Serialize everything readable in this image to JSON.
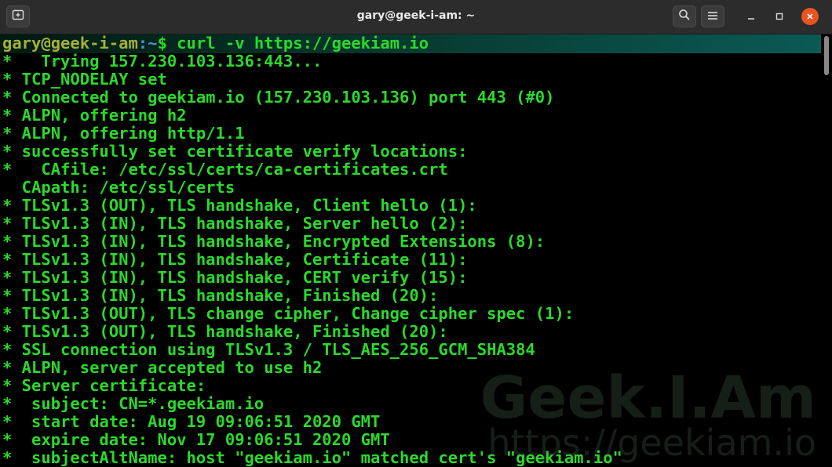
{
  "window": {
    "title": "gary@geek-i-am: ~",
    "new_tab_icon": "new-tab-icon",
    "search_icon": "search-icon",
    "menu_icon": "hamburger-menu-icon",
    "close_color": "#e95420"
  },
  "prompt": {
    "user_host": "gary@geek-i-am",
    "path": ":~",
    "symbol": "$ ",
    "command": "curl -v https://geekiam.io"
  },
  "output_lines": [
    "*   Trying 157.230.103.136:443...",
    "* TCP_NODELAY set",
    "* Connected to geekiam.io (157.230.103.136) port 443 (#0)",
    "* ALPN, offering h2",
    "* ALPN, offering http/1.1",
    "* successfully set certificate verify locations:",
    "*   CAfile: /etc/ssl/certs/ca-certificates.crt",
    "  CApath: /etc/ssl/certs",
    "* TLSv1.3 (OUT), TLS handshake, Client hello (1):",
    "* TLSv1.3 (IN), TLS handshake, Server hello (2):",
    "* TLSv1.3 (IN), TLS handshake, Encrypted Extensions (8):",
    "* TLSv1.3 (IN), TLS handshake, Certificate (11):",
    "* TLSv1.3 (IN), TLS handshake, CERT verify (15):",
    "* TLSv1.3 (IN), TLS handshake, Finished (20):",
    "* TLSv1.3 (OUT), TLS change cipher, Change cipher spec (1):",
    "* TLSv1.3 (OUT), TLS handshake, Finished (20):",
    "* SSL connection using TLSv1.3 / TLS_AES_256_GCM_SHA384",
    "* ALPN, server accepted to use h2",
    "* Server certificate:",
    "*  subject: CN=*.geekiam.io",
    "*  start date: Aug 19 09:06:51 2020 GMT",
    "*  expire date: Nov 17 09:06:51 2020 GMT",
    "*  subjectAltName: host \"geekiam.io\" matched cert's \"geekiam.io\""
  ],
  "watermark": {
    "brand": "Geek.I.Am",
    "url": "https://geekiam.io"
  },
  "colors": {
    "output_green": "#2bd92b",
    "prompt_user": "#a4b03a",
    "prompt_path": "#4f8fd0",
    "titlebar": "#2c2c2c"
  }
}
